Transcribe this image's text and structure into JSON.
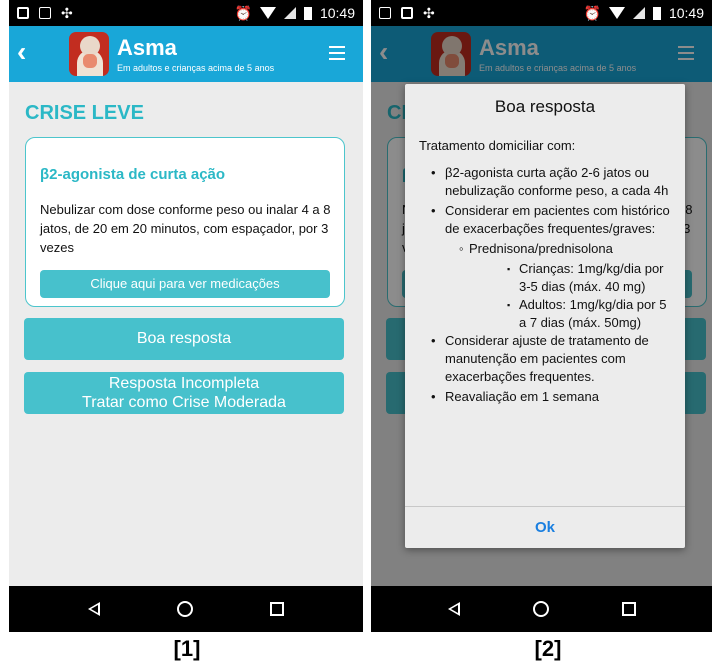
{
  "status": {
    "time": "10:49"
  },
  "app": {
    "title": "Asma",
    "subtitle": "Em adultos e crianças acima de 5 anos"
  },
  "screen1": {
    "section_title": "CRISE LEVE",
    "card": {
      "title": "β2-agonista de curta ação",
      "text": "Nebulizar com dose conforme peso ou inalar 4 a 8 jatos, de 20 em 20 minutos, com espaçador, por 3 vezes",
      "button": "Clique aqui para ver medicações"
    },
    "btn_boa": "Boa resposta",
    "btn_inc_line1": "Resposta Incompleta",
    "btn_inc_line2": "Tratar como Crise Moderada"
  },
  "dialog": {
    "title": "Boa resposta",
    "intro": "Tratamento domiciliar com:",
    "item1": "β2-agonista curta ação 2-6 jatos ou nebulização conforme peso, a cada 4h",
    "item2": "Considerar em pacientes com histórico de exacerbações frequentes/graves:",
    "item2_sub": "Prednisona/prednisolona",
    "item2_sub_a": "Crianças: 1mg/kg/dia por 3-5 dias (máx. 40 mg)",
    "item2_sub_b": "Adultos: 1mg/kg/dia por 5 a 7 dias (máx. 50mg)",
    "item3": "Considerar ajuste de tratamento de manutenção em pacientes com exacerbações frequentes.",
    "item4": "Reavaliação em 1 semana",
    "ok": "Ok"
  },
  "captions": {
    "left": "[1]",
    "right": "[2]"
  },
  "colors": {
    "appbar": "#19a7d8",
    "teal": "#47c1cc",
    "title_teal": "#2bb8c6",
    "ok_blue": "#1a7fe0"
  }
}
